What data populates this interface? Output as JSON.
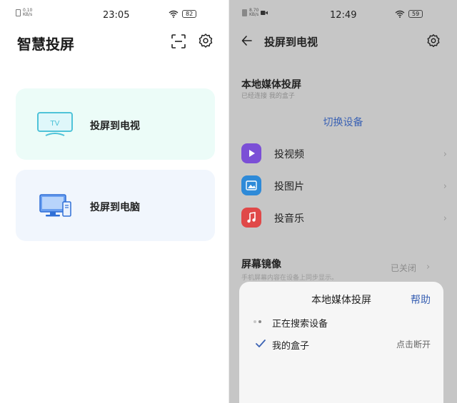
{
  "left": {
    "status": {
      "speed_value": "0.10",
      "speed_unit": "KB/s",
      "time": "23:05",
      "battery": "82"
    },
    "title": "智慧投屏",
    "cards": [
      {
        "label": "投屏到电视",
        "icon_text": "TV",
        "icon": "tv-icon"
      },
      {
        "label": "投屏到电脑",
        "icon": "computer-icon"
      }
    ],
    "icons": [
      "scan-icon",
      "gear-icon"
    ],
    "colors": {
      "tv_card_bg": "#ecfcf8",
      "pc_card_bg": "#f1f6fd",
      "accent": "#4fc3d8"
    }
  },
  "right": {
    "status": {
      "speed_value": "8.70",
      "speed_unit": "KB/s",
      "time": "12:49",
      "battery": "59"
    },
    "title": "投屏到电视",
    "local_media": {
      "title": "本地媒体投屏",
      "subtitle": "已经连接 我的盒子",
      "switch_label": "切换设备"
    },
    "items": [
      {
        "label": "投视频",
        "icon": "video-icon",
        "color": "#7b4fd6"
      },
      {
        "label": "投图片",
        "icon": "picture-icon",
        "color": "#2e8ad8"
      },
      {
        "label": "投音乐",
        "icon": "music-icon",
        "color": "#e04848"
      }
    ],
    "mirror": {
      "title": "屏幕镜像",
      "subtitle": "手机屏幕内容在设备上同步显示。",
      "value": "已关闭"
    },
    "sheet": {
      "title": "本地媒体投屏",
      "help": "帮助",
      "searching": "正在搜索设备",
      "device": "我的盒子",
      "disconnect": "点击断开"
    },
    "colors": {
      "link": "#3c63b4",
      "overlay_bg": "#c6c6c6"
    }
  }
}
